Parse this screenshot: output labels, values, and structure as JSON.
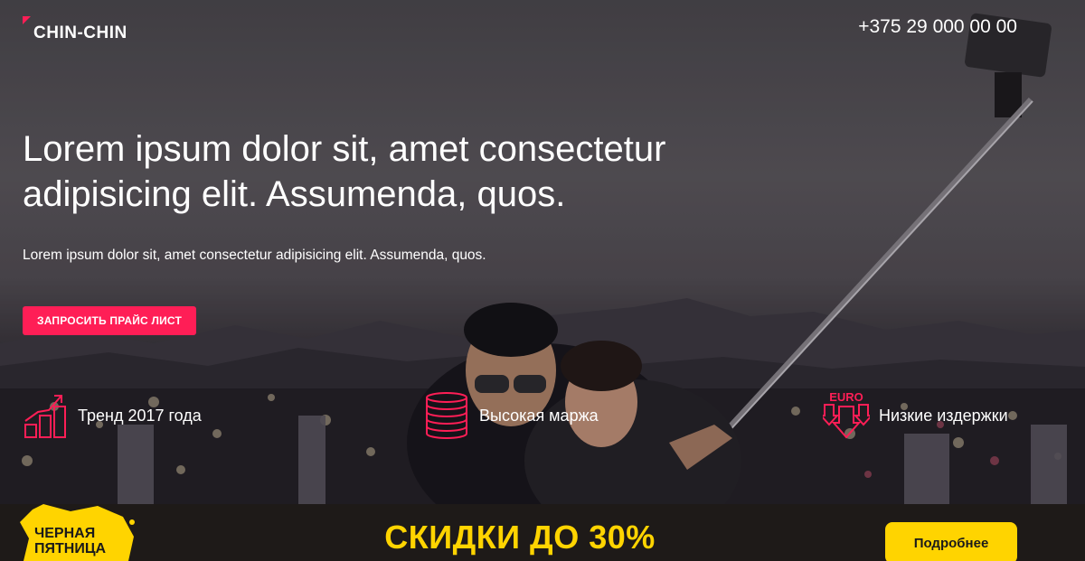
{
  "header": {
    "logo_text": "CHIN-CHIN",
    "phone": "+375 29 000 00 00"
  },
  "hero": {
    "headline": "Lorem ipsum dolor sit, amet consectetur adipisicing elit. Assumenda, quos.",
    "subtext": "Lorem ipsum dolor sit, amet consectetur adipisicing elit. Assumenda, quos.",
    "cta_label": "ЗАПРОСИТЬ ПРАЙС ЛИСТ"
  },
  "features": [
    {
      "icon": "trend-chart-icon",
      "label": "Тренд 2017 года"
    },
    {
      "icon": "coins-stack-icon",
      "label": "Высокая маржа"
    },
    {
      "icon": "euro-down-icon",
      "label": "Низкие издержки",
      "icon_text": "EURO"
    }
  ],
  "promo": {
    "badge_text": "ЧЕРНАЯ ПЯТНИЦА",
    "title": "СКИДКИ ДО 30%",
    "button_label": "Подробнее"
  },
  "colors": {
    "accent": "#ff1e56",
    "promo_yellow": "#ffd400",
    "promo_bg": "#1e1a18"
  }
}
